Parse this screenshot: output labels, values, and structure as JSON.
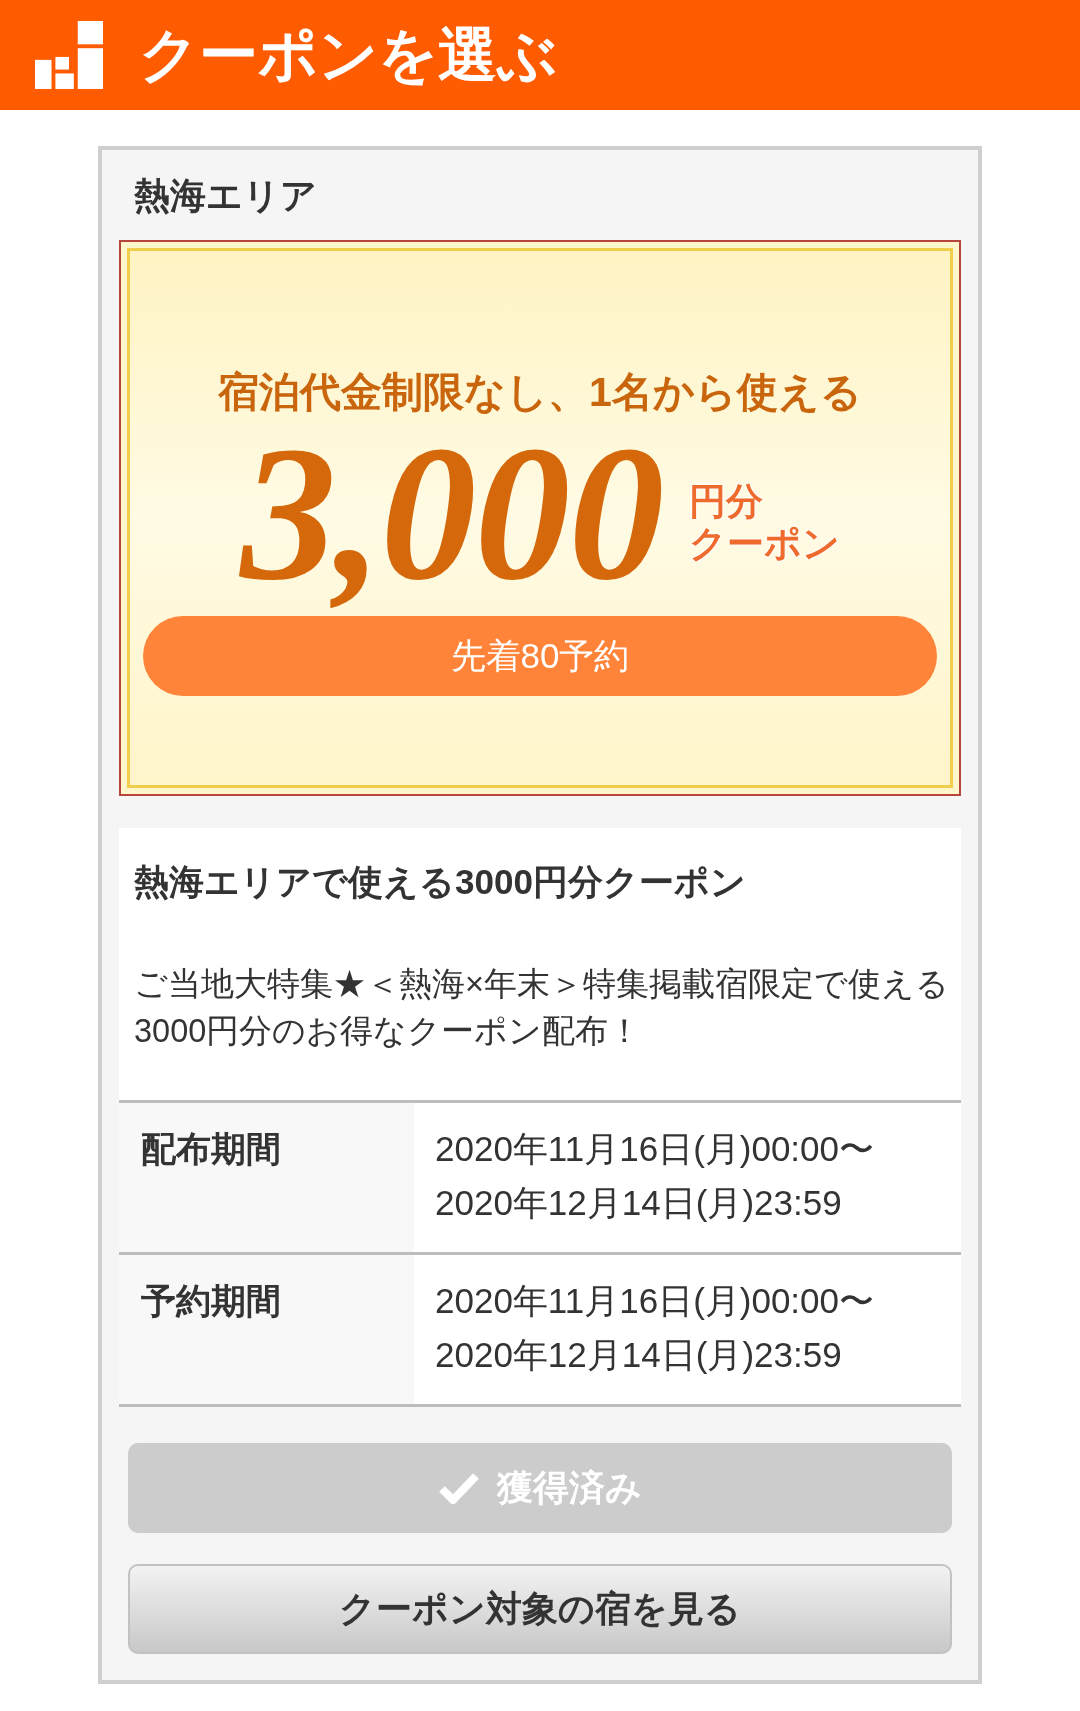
{
  "header": {
    "title": "クーポンを選ぶ"
  },
  "area": {
    "name": "熱海エリア"
  },
  "coupon": {
    "condition": "宿泊代金制限なし、1名から使える",
    "amount": "3,000",
    "unit_lines": [
      "円分",
      "クーポン"
    ],
    "limit": "先着80予約"
  },
  "detail": {
    "title": "熱海エリアで使える3000円分クーポン",
    "description": "ご当地大特集★＜熱海×年末＞特集掲載宿限定で使える3000円分のお得なクーポン配布！"
  },
  "periods": [
    {
      "label": "配布期間",
      "lines": [
        "2020年11月16日(月)00:00〜",
        "2020年12月14日(月)23:59"
      ]
    },
    {
      "label": "予約期間",
      "lines": [
        "2020年11月16日(月)00:00〜",
        "2020年12月14日(月)23:59"
      ]
    }
  ],
  "buttons": [
    {
      "kind": "acquired",
      "label": "獲得済み",
      "disabled": true
    },
    {
      "kind": "link",
      "label": "クーポン対象の宿を見る",
      "disabled": false
    }
  ]
}
